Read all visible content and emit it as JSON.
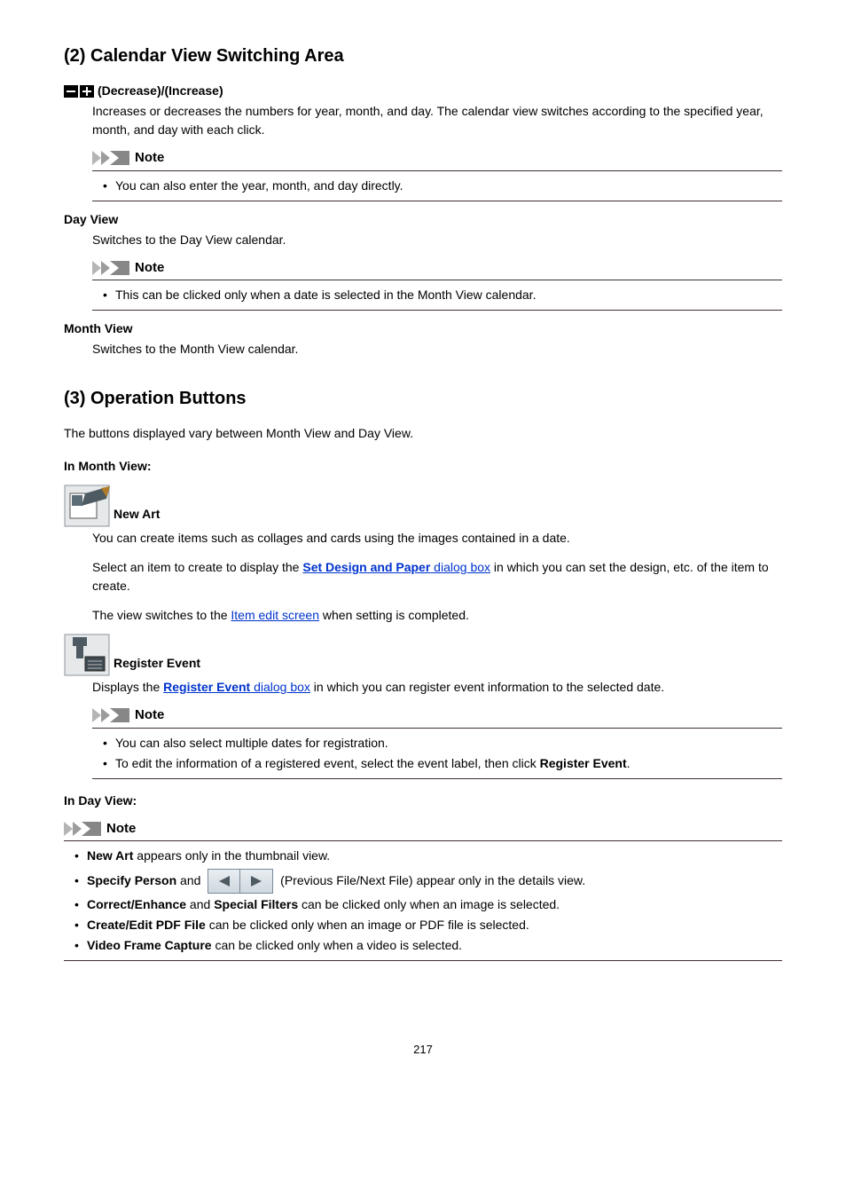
{
  "section2": {
    "heading": "(2) Calendar View Switching Area",
    "decInc": {
      "term": "(Decrease)/(Increase)",
      "body": "Increases or decreases the numbers for year, month, and day. The calendar view switches according to the specified year, month, and day with each click.",
      "note_label": "Note",
      "note_item": "You can also enter the year, month, and day directly."
    },
    "dayView": {
      "term": "Day View",
      "body": "Switches to the Day View calendar.",
      "note_label": "Note",
      "note_item": "This can be clicked only when a date is selected in the Month View calendar."
    },
    "monthView": {
      "term": "Month View",
      "body": "Switches to the Month View calendar."
    }
  },
  "section3": {
    "heading": "(3) Operation Buttons",
    "intro": "The buttons displayed vary between Month View and Day View.",
    "inMonth": {
      "label": "In Month View:",
      "newArt": {
        "label": "New Art",
        "p1": "You can create items such as collages and cards using the images contained in a date.",
        "p2a": "Select an item to create to display the ",
        "p2_link": "Set Design and Paper",
        "p2_link_tail": " dialog box",
        "p2b": " in which you can set the design, etc. of the item to create.",
        "p3a": "The view switches to the ",
        "p3_link": "Item edit screen",
        "p3b": " when setting is completed."
      },
      "regEvent": {
        "label": "Register Event",
        "p1a": "Displays the ",
        "p1_link": "Register Event",
        "p1_link_tail": " dialog box",
        "p1b": " in which you can register event information to the selected date.",
        "note_label": "Note",
        "note1": "You can also select multiple dates for registration.",
        "note2a": "To edit the information of a registered event, select the event label, then click ",
        "note2b": "Register Event",
        "note2c": "."
      }
    },
    "inDay": {
      "label": "In Day View:",
      "note_label": "Note",
      "li1a": "New Art",
      "li1b": " appears only in the thumbnail view.",
      "li2a": "Specify Person",
      "li2b": " and ",
      "li2c": " (Previous File/Next File) appear only in the details view.",
      "li3a": "Correct/Enhance",
      "li3b": " and ",
      "li3c": "Special Filters",
      "li3d": " can be clicked only when an image is selected.",
      "li4a": "Create/Edit PDF File",
      "li4b": " can be clicked only when an image or PDF file is selected.",
      "li5a": "Video Frame Capture",
      "li5b": " can be clicked only when a video is selected."
    }
  },
  "pageNumber": "217"
}
